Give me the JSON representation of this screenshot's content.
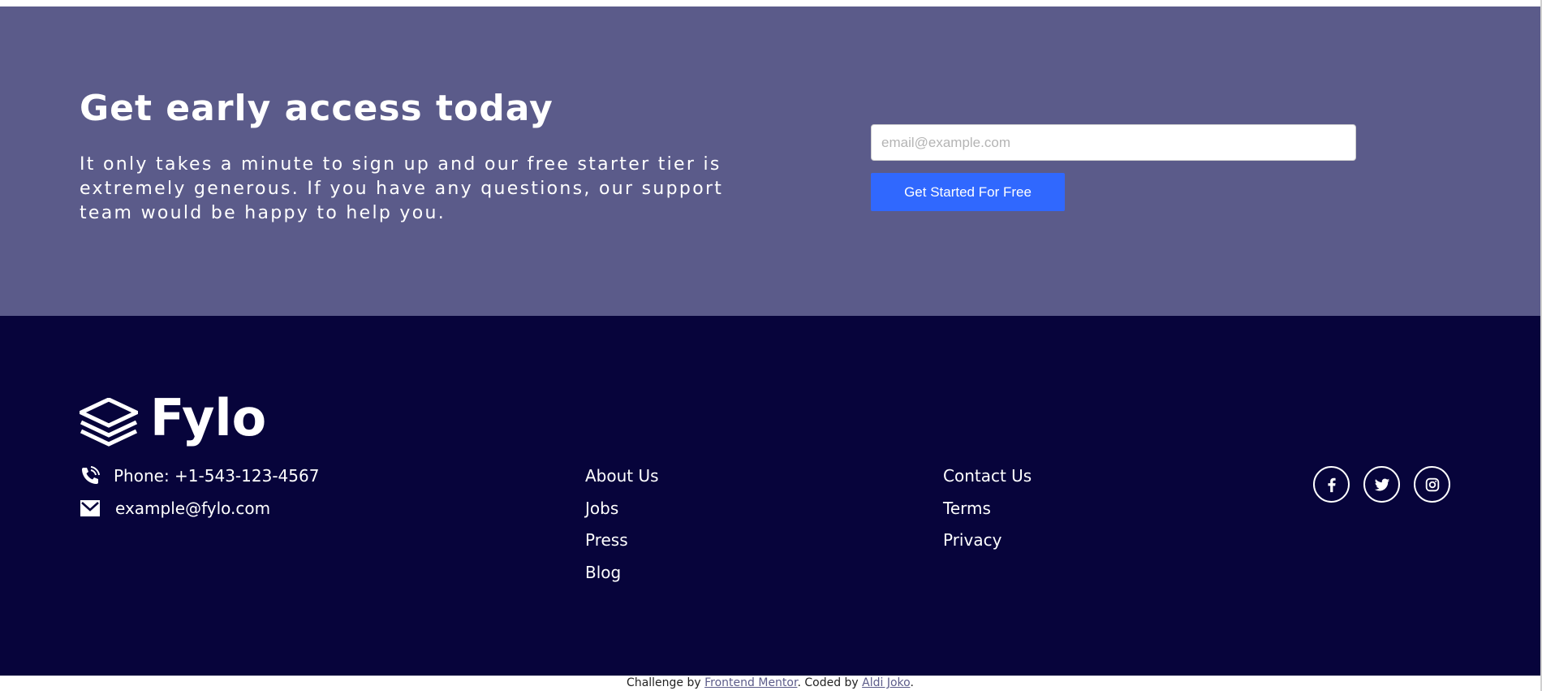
{
  "cta": {
    "title": "Get early access today",
    "text": "It only takes a minute to sign up and our free starter tier is extremely generous. If you have any questions, our support team would be happy to help you.",
    "email_placeholder": "email@example.com",
    "button_label": "Get Started For Free"
  },
  "footer": {
    "brand": "Fylo",
    "phone": "Phone: +1-543-123-4567",
    "email": "example@fylo.com",
    "links_col1": [
      "About Us",
      "Jobs",
      "Press",
      "Blog"
    ],
    "links_col2": [
      "Contact Us",
      "Terms",
      "Privacy"
    ],
    "socials": [
      "facebook-icon",
      "twitter-icon",
      "instagram-icon"
    ]
  },
  "attribution": {
    "prefix": "Challenge by ",
    "mentor": "Frontend Mentor",
    "middle": ". Coded by ",
    "author": "Aldi Joko",
    "suffix": "."
  },
  "colors": {
    "cta_bg": "#5b5b8a",
    "footer_bg": "#07043b",
    "button": "#3068fe",
    "link": "#5c5c8a"
  }
}
